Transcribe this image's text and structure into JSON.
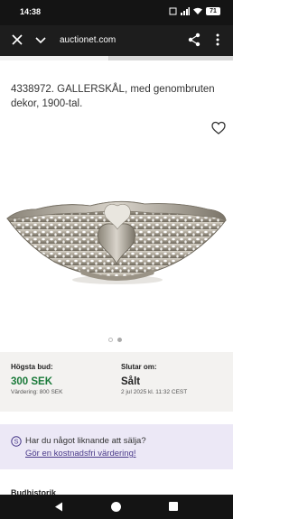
{
  "status_bar": {
    "time": "14:38",
    "battery": "71"
  },
  "browser": {
    "url": "auctionet.com",
    "load_progress": 0.47
  },
  "listing": {
    "title": "4338972. GALLERSKÅL, med genombruten dekor, 1900-tal.",
    "image_alt": "Silver gallery bowl with pierced decoration",
    "image_count": 2,
    "active_image": 1
  },
  "bid": {
    "highest_label": "Högsta bud:",
    "highest_value": "300 SEK",
    "estimate": "Värdering: 800 SEK",
    "ends_label": "Slutar om:",
    "ends_value": "Sålt",
    "ends_date": "2 jul 2025 kl. 11:32 CEST"
  },
  "sell": {
    "question": "Har du något liknande att sälja?",
    "link": "Gör en kostnadsfri värdering!"
  },
  "section": {
    "title": "Budhistorik"
  },
  "colors": {
    "accent_green": "#1a7a3a",
    "sell_bg": "#ece8f6",
    "link": "#4a3a8a"
  },
  "icons": [
    "close-icon",
    "chevron-down-icon",
    "share-icon",
    "more-icon",
    "heart-icon",
    "info-icon",
    "back-icon",
    "home-icon",
    "recent-apps-icon"
  ]
}
